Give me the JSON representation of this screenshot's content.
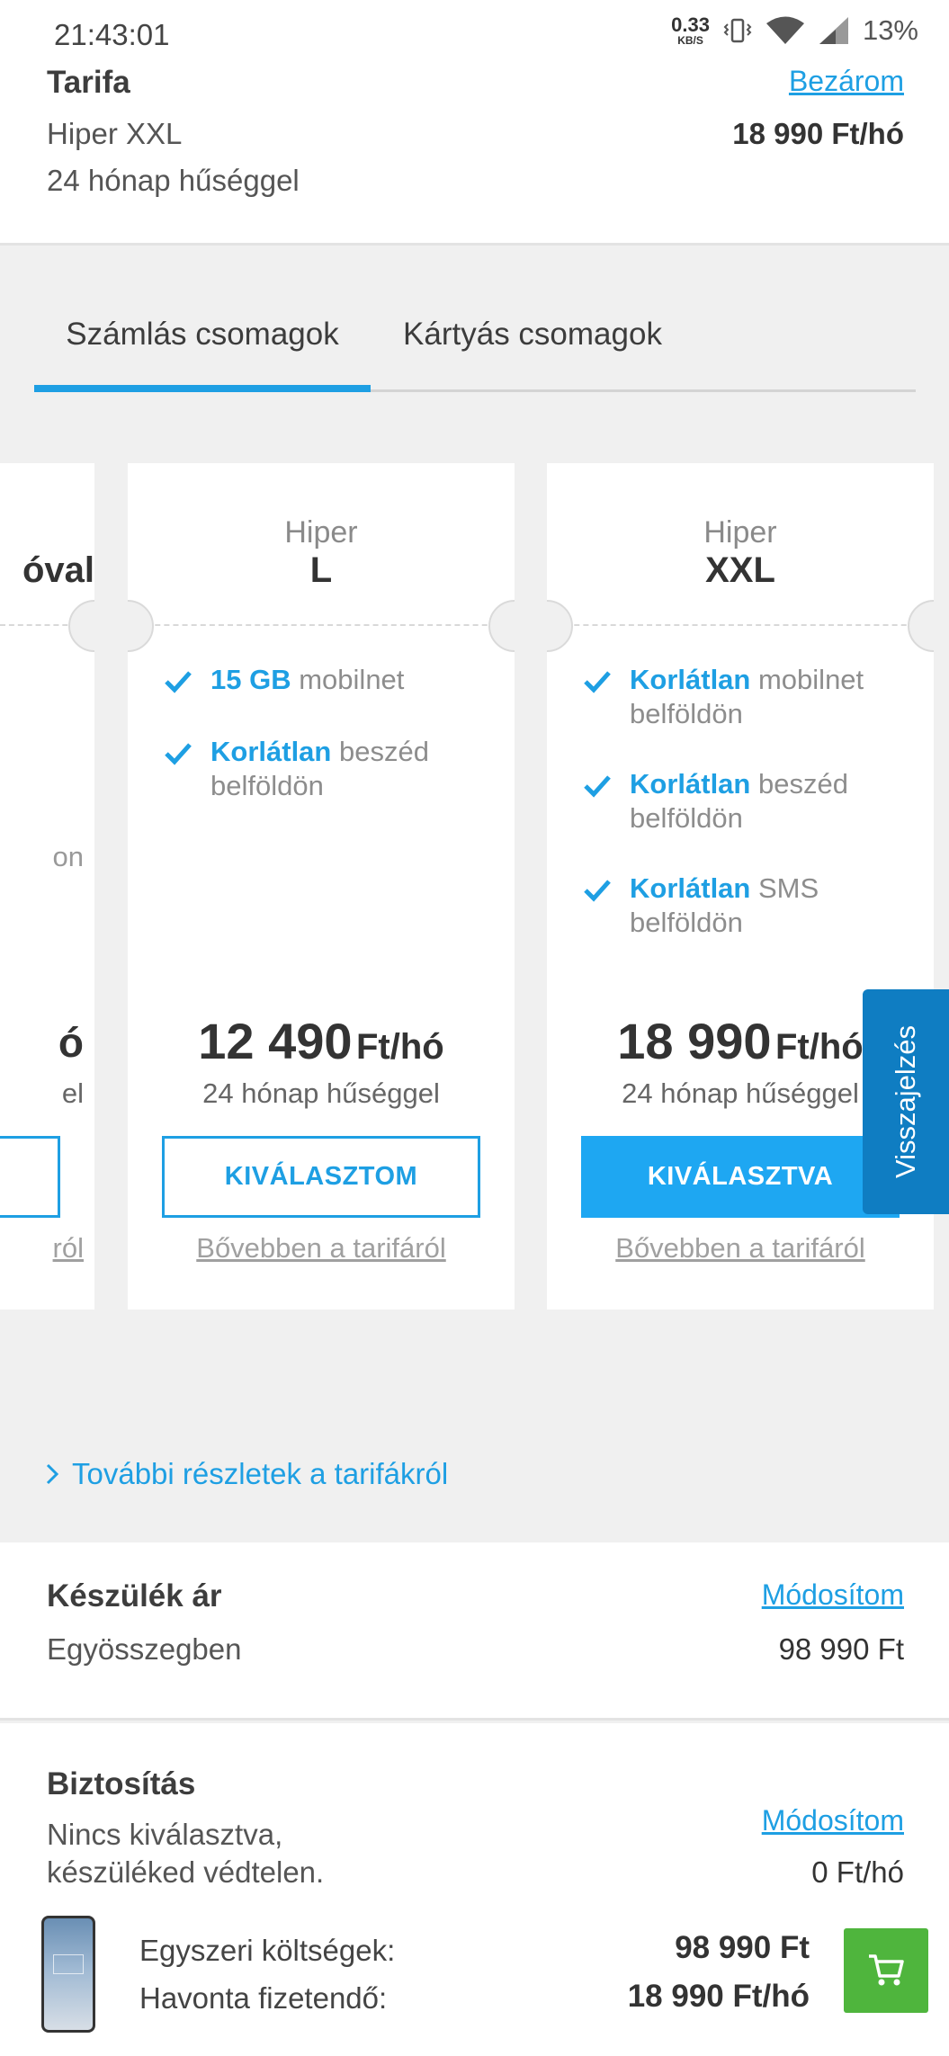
{
  "status": {
    "time": "21:43:01",
    "net_speed": "0.33",
    "net_unit": "KB/S",
    "battery": "13%"
  },
  "summary": {
    "title": "Tarifa",
    "plan": "Hiper XXL",
    "commitment": "24 hónap hűséggel",
    "close_label": "Bezárom",
    "price": "18 990 Ft/hó"
  },
  "tabs": [
    {
      "label": "Számlás csomagok",
      "active": true
    },
    {
      "label": "Kártyás csomagok",
      "active": false
    }
  ],
  "partial_card": {
    "name_fragment": "óval",
    "feature_fragment": "on",
    "price_fragment": "ó",
    "commit_fragment": "el",
    "link_fragment": "ról"
  },
  "plans": [
    {
      "name_line1": "Hiper",
      "name_line2": "L",
      "features": [
        {
          "highlight": "15 GB",
          "text": "mobilnet"
        },
        {
          "highlight": "Korlátlan",
          "text": "beszéd belföldön"
        }
      ],
      "price": "12 490",
      "price_unit": "Ft/hó",
      "commitment": "24 hónap hűséggel",
      "button_label": "KIVÁLASZTOM",
      "selected": false,
      "more_link": "Bővebben a tarifáról"
    },
    {
      "name_line1": "Hiper",
      "name_line2": "XXL",
      "features": [
        {
          "highlight": "Korlátlan",
          "text": "mobilnet belföldön"
        },
        {
          "highlight": "Korlátlan",
          "text": "beszéd belföldön"
        },
        {
          "highlight": "Korlátlan",
          "text": "SMS belföldön"
        }
      ],
      "price": "18 990",
      "price_unit": "Ft/hó",
      "commitment": "24 hónap hűséggel",
      "button_label": "KIVÁLASZTVA",
      "selected": true,
      "more_link": "Bővebben a tarifáról"
    }
  ],
  "feedback_label": "Visszajelzés",
  "details_link": "További részletek a tarifákról",
  "device": {
    "title": "Készülék ár",
    "payment": "Egyösszegben",
    "modify_label": "Módosítom",
    "price": "98 990 Ft"
  },
  "insurance": {
    "title": "Biztosítás",
    "text_line1": "Nincs kiválasztva,",
    "text_line2": "készüléked védtelen.",
    "modify_label": "Módosítom",
    "price": "0 Ft/hó"
  },
  "footer": {
    "one_time_label": "Egyszeri költségek:",
    "one_time_value": "98 990 Ft",
    "monthly_label": "Havonta fizetendő:",
    "monthly_value": "18 990 Ft/hó"
  },
  "colors": {
    "accent": "#1e9fe3",
    "selected_button": "#1ea7f2",
    "feedback": "#0f7dc2",
    "cart": "#4fb53d"
  },
  "icons": [
    "vibrate-icon",
    "wifi-icon",
    "signal-icon",
    "check-icon",
    "chevron-right-icon",
    "cart-icon"
  ]
}
